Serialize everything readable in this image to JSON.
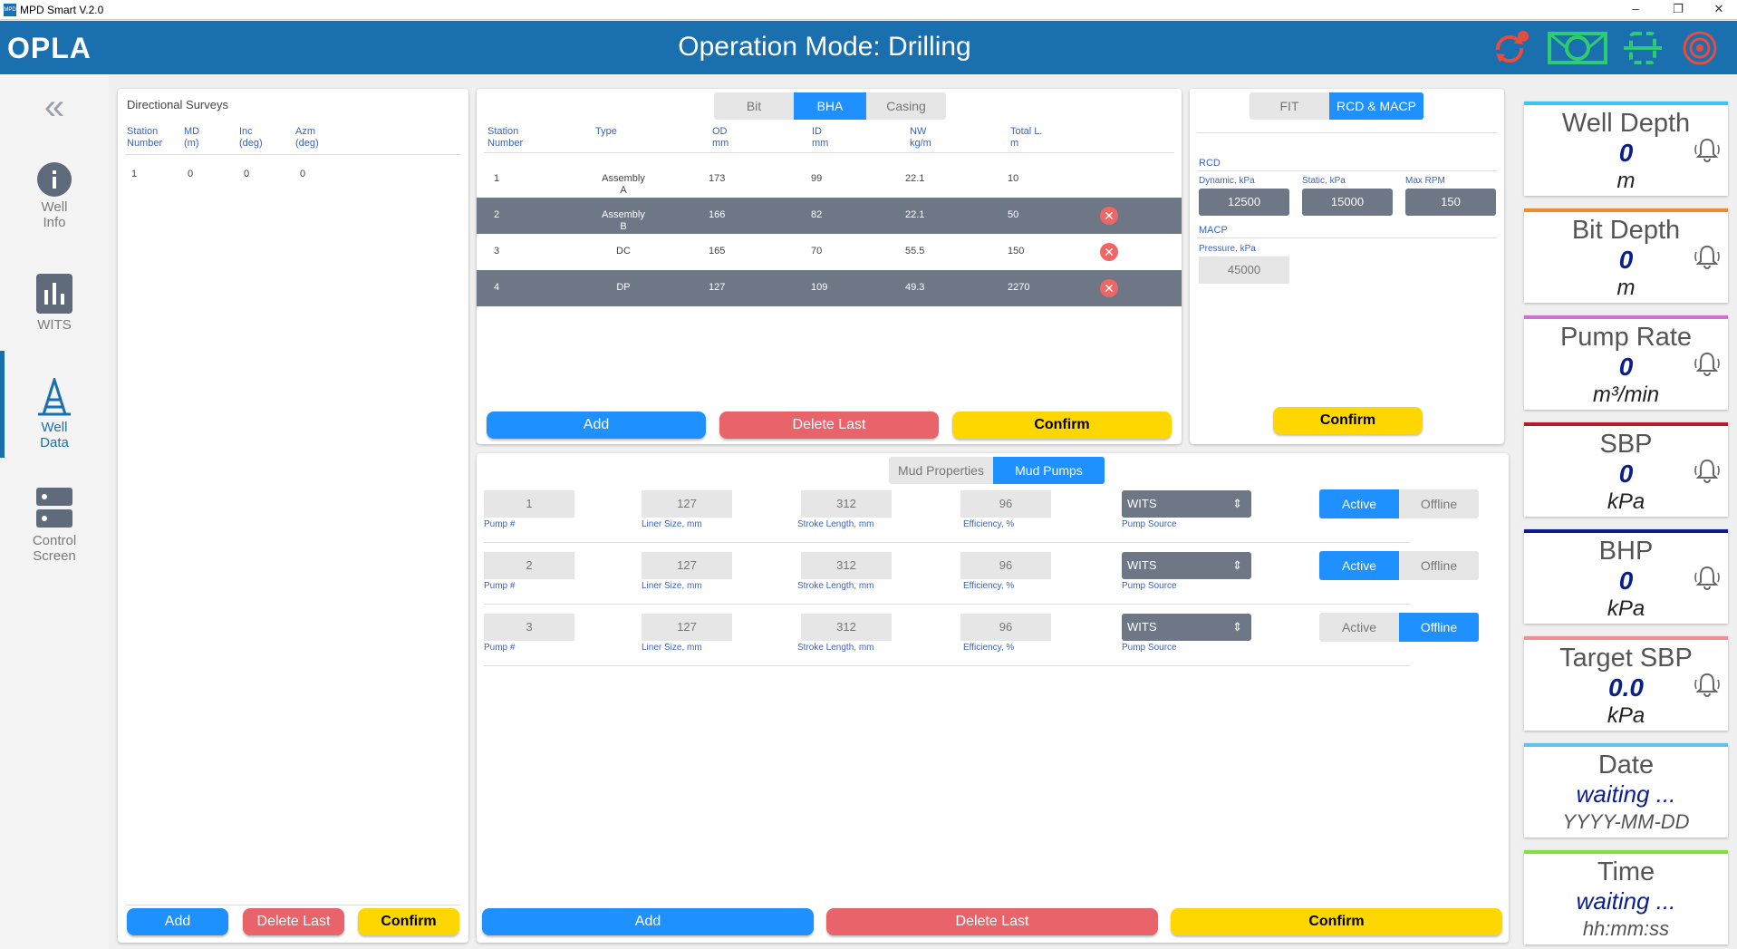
{
  "window": {
    "title": "MPD Smart V.2.0",
    "icon_text": "MPD",
    "minimize": "–",
    "restore": "❐",
    "close": "✕"
  },
  "header": {
    "logo": "OPLA",
    "operation_mode": "Operation Mode: Drilling",
    "icons": [
      "sync-alert-icon",
      "rig-icon",
      "connection-icon",
      "signal-icon"
    ],
    "colors": {
      "background": "#1a6fae",
      "sync": "#e74c3c",
      "rig": "#2ecc71"
    }
  },
  "sidebar": {
    "collapse": "«",
    "items": [
      {
        "id": "well-info",
        "label": "Well Info"
      },
      {
        "id": "wits",
        "label": "WITS"
      },
      {
        "id": "well-data",
        "label": "Well Data",
        "active": true
      },
      {
        "id": "control-screen",
        "label": "Control Screen"
      }
    ]
  },
  "surveys": {
    "title": "Directional Surveys",
    "columns": [
      {
        "line1": "Station",
        "line2": "Number"
      },
      {
        "line1": "MD",
        "line2": "(m)"
      },
      {
        "line1": "Inc",
        "line2": "(deg)"
      },
      {
        "line1": "Azm",
        "line2": "(deg)"
      }
    ],
    "rows": [
      [
        "1",
        "0",
        "0",
        "0"
      ]
    ],
    "add": "Add",
    "delete": "Delete Last",
    "confirm": "Confirm"
  },
  "bha": {
    "tabs": [
      "Bit",
      "BHA",
      "Casing"
    ],
    "active_tab": "BHA",
    "columns": [
      {
        "line1": "Station",
        "line2": "Number"
      },
      {
        "line1": "Type",
        "line2": ""
      },
      {
        "line1": "OD",
        "line2": "mm"
      },
      {
        "line1": "ID",
        "line2": "mm"
      },
      {
        "line1": "NW",
        "line2": "kg/m"
      },
      {
        "line1": "Total L.",
        "line2": "m"
      }
    ],
    "rows": [
      {
        "num": "1",
        "type": "Assembly",
        "type2": "A",
        "od": "173",
        "id": "99",
        "nw": "22.1",
        "len": "10",
        "dark": false,
        "del": false
      },
      {
        "num": "2",
        "type": "Assembly",
        "type2": "B",
        "od": "166",
        "id": "82",
        "nw": "22.1",
        "len": "50",
        "dark": true,
        "del": true
      },
      {
        "num": "3",
        "type": "DC",
        "type2": "",
        "od": "165",
        "id": "70",
        "nw": "55.5",
        "len": "150",
        "dark": false,
        "del": true
      },
      {
        "num": "4",
        "type": "DP",
        "type2": "",
        "od": "127",
        "id": "109",
        "nw": "49.3",
        "len": "2270",
        "dark": true,
        "del": true
      }
    ],
    "add": "Add",
    "delete": "Delete Last",
    "confirm": "Confirm"
  },
  "rcd": {
    "tabs": [
      "FIT",
      "RCD & MACP"
    ],
    "active_tab": "RCD & MACP",
    "rcd_label": "RCD",
    "dynamic_label": "Dynamic, kPa",
    "dynamic": "12500",
    "static_label": "Static, kPa",
    "static": "15000",
    "rpm_label": "Max RPM",
    "rpm": "150",
    "macp_label": "MACP",
    "pressure_label": "Pressure, kPa",
    "pressure": "45000",
    "confirm": "Confirm"
  },
  "mud": {
    "tabs": [
      "Mud Properties",
      "Mud Pumps"
    ],
    "active_tab": "Mud Pumps",
    "labels": {
      "pump": "Pump #",
      "liner": "Liner Size, mm",
      "stroke": "Stroke Length, mm",
      "eff": "Efficiency, %",
      "source": "Pump Source",
      "active": "Active",
      "offline": "Offline"
    },
    "pumps": [
      {
        "num": "1",
        "liner": "127",
        "stroke": "312",
        "eff": "96",
        "source": "WITS",
        "status": "Active"
      },
      {
        "num": "2",
        "liner": "127",
        "stroke": "312",
        "eff": "96",
        "source": "WITS",
        "status": "Active"
      },
      {
        "num": "3",
        "liner": "127",
        "stroke": "312",
        "eff": "96",
        "source": "WITS",
        "status": "Offline"
      }
    ],
    "add": "Add",
    "delete": "Delete Last",
    "confirm": "Confirm"
  },
  "cards": [
    {
      "title": "Well Depth",
      "value": "0",
      "unit": "m",
      "color": "#3cc4f0"
    },
    {
      "title": "Bit Depth",
      "value": "0",
      "unit": "m",
      "color": "#f08a30"
    },
    {
      "title": "Pump Rate",
      "value": "0",
      "unit": "m³/min",
      "color": "#d070d0"
    },
    {
      "title": "SBP",
      "value": "0",
      "unit": "kPa",
      "color": "#b0202a"
    },
    {
      "title": "BHP",
      "value": "0",
      "unit": "kPa",
      "color": "#101a90"
    },
    {
      "title": "Target SBP",
      "value": "0.0",
      "unit": "kPa",
      "color": "#f09090"
    },
    {
      "title": "Date",
      "value": "waiting ...",
      "unit": "YYYY-MM-DD",
      "color": "#60c0f0"
    },
    {
      "title": "Time",
      "value": "waiting ...",
      "unit": "hh:mm:ss",
      "color": "#80e040"
    }
  ]
}
